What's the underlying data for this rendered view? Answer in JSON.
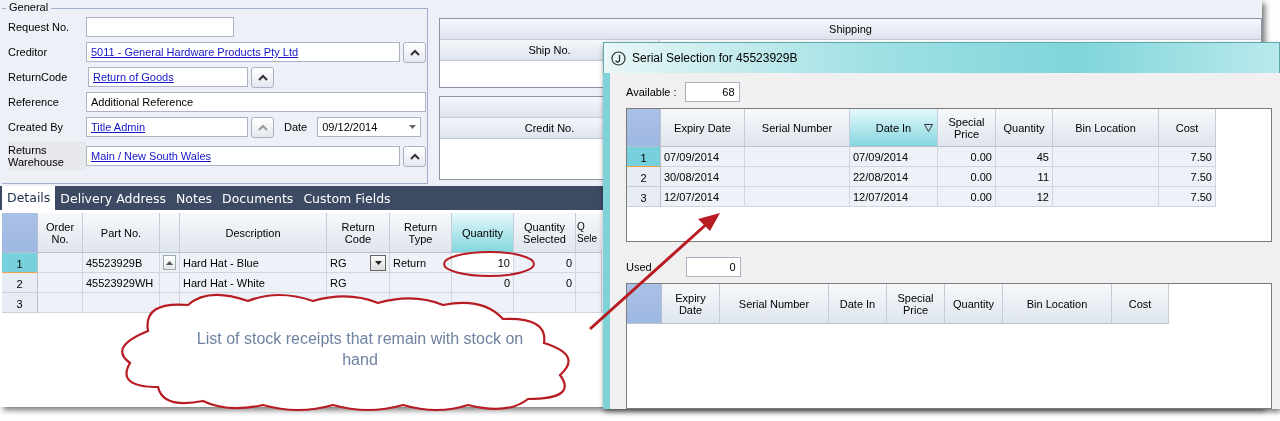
{
  "general": {
    "title": "General",
    "fields": [
      {
        "kind": "text",
        "label": "Request No."
      },
      {
        "kind": "lookup",
        "label": "Creditor",
        "value": "5011 - General Hardware Products Pty Ltd"
      },
      {
        "kind": "lookup_short",
        "label": "ReturnCode",
        "value": "Return of Goods"
      },
      {
        "kind": "text_long",
        "label": "Reference",
        "value": "Additional Reference"
      },
      {
        "kind": "lookup_date",
        "label": "Created By",
        "value": "Title Admin",
        "date_label": "Date",
        "date": "09/12/2014"
      },
      {
        "kind": "lookup",
        "label": "Returns Warehouse",
        "value": "Main / New South Wales"
      }
    ]
  },
  "shipping": {
    "title": "Shipping",
    "columns": [
      "Ship No."
    ]
  },
  "credit": {
    "columns": [
      "Credit No."
    ]
  },
  "tabs": [
    {
      "label": "Details",
      "selected": true
    },
    {
      "label": "Delivery Address",
      "selected": false
    },
    {
      "label": "Notes",
      "selected": false
    },
    {
      "label": "Documents",
      "selected": false
    },
    {
      "label": "Custom Fields",
      "selected": false
    }
  ],
  "grid": {
    "columns": [
      {
        "label": "Order No.",
        "selected": false
      },
      {
        "label": "Part No.",
        "selected": false
      },
      {
        "kind": "button",
        "selected": false
      },
      {
        "label": "Description",
        "selected": false
      },
      {
        "label": "Return Code",
        "selected": false
      },
      {
        "label": "Return Type",
        "selected": false
      },
      {
        "label": "Quantity",
        "selected": true
      },
      {
        "label": "Quantity Selected",
        "selected": false
      },
      {
        "label": "Q Sele",
        "selected": false
      }
    ],
    "rows": [
      {
        "number": "1",
        "selected": true,
        "cells": [
          null,
          "45523929B",
          null,
          "Hard Hat - Blue",
          "RG",
          "Return",
          "10",
          "0",
          null
        ]
      },
      {
        "number": "2",
        "selected": false,
        "cells": [
          null,
          "45523929WH",
          null,
          "Hard Hat - White",
          "RG",
          null,
          "0",
          "0",
          null
        ]
      },
      {
        "number": "3",
        "selected": false,
        "cells": [
          null,
          null,
          null,
          null,
          null,
          null,
          null,
          null,
          null
        ]
      }
    ]
  },
  "dialog": {
    "title": "Serial Selection for 45523929B",
    "available_label": "Available :",
    "available": "68",
    "available_grid": {
      "columns": [
        {
          "label": "Expiry Date",
          "selected": false,
          "sorted": false
        },
        {
          "label": "Serial Number",
          "selected": false,
          "sorted": false
        },
        {
          "label": "Date In",
          "selected": true,
          "sorted": true
        },
        {
          "label": "Special Price",
          "selected": false,
          "sorted": false
        },
        {
          "label": "Quantity",
          "selected": false,
          "sorted": false
        },
        {
          "label": "Bin Location",
          "selected": false,
          "sorted": false
        },
        {
          "label": "Cost",
          "selected": false,
          "sorted": false
        }
      ],
      "rows": [
        {
          "number": "1",
          "selected": true,
          "cells": [
            "07/09/2014",
            null,
            "07/09/2014",
            "0.00",
            "45",
            null,
            "7.50"
          ]
        },
        {
          "number": "2",
          "selected": false,
          "cells": [
            "30/08/2014",
            null,
            "22/08/2014",
            "0.00",
            "11",
            null,
            "7.50"
          ]
        },
        {
          "number": "3",
          "selected": false,
          "cells": [
            "12/07/2014",
            null,
            "12/07/2014",
            "0.00",
            "12",
            null,
            "7.50"
          ]
        }
      ]
    },
    "used_label": "Used",
    "used": "0",
    "used_grid": {
      "columns": [
        {
          "label": "Expiry Date",
          "selected": false,
          "sorted": false
        },
        {
          "label": "Serial Number",
          "selected": false,
          "sorted": false
        },
        {
          "label": "Date In",
          "selected": false,
          "sorted": false
        },
        {
          "label": "Special Price",
          "selected": false,
          "sorted": false
        },
        {
          "label": "Quantity",
          "selected": false,
          "sorted": false
        },
        {
          "label": "Bin Location",
          "selected": false,
          "sorted": false
        },
        {
          "label": "Cost",
          "selected": false,
          "sorted": false
        }
      ]
    }
  },
  "callout": {
    "text": "List of stock receipts that remain with stock on hand"
  }
}
